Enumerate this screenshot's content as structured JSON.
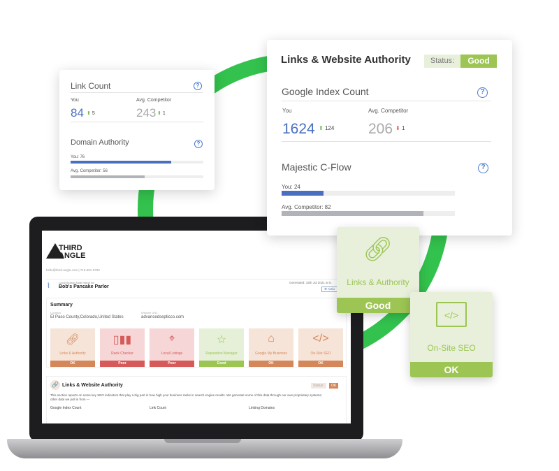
{
  "link_card": {
    "title": "Link Count",
    "you_label": "You",
    "comp_label": "Avg. Competitor",
    "you_value": "84",
    "you_delta": "5",
    "comp_value": "243",
    "comp_delta": "1",
    "da_title": "Domain Authority",
    "da_you": "You: 76",
    "da_comp": "Avg. Competitor: 56",
    "da_you_pct": 76,
    "da_comp_pct": 56
  },
  "authority_card": {
    "title": "Links & Website Authority",
    "status_label": "Status:",
    "status": "Good",
    "gic_title": "Google Index Count",
    "you_label": "You",
    "comp_label": "Avg. Competitor",
    "you_value": "1624",
    "you_delta": "124",
    "comp_value": "206",
    "comp_delta": "1",
    "cflow_title": "Majestic C-Flow",
    "cflow_you": "You: 24",
    "cflow_comp": "Avg. Competitor: 82",
    "cflow_you_pct": 24,
    "cflow_comp_pct": 82
  },
  "green_tiles": [
    {
      "label": "Links & Authority",
      "status": "Good",
      "icon": "link-icon"
    },
    {
      "label": "On-Site SEO",
      "status": "OK",
      "icon": "code-icon"
    }
  ],
  "report": {
    "logo": "THIRD ANGLE",
    "contact": "hello@third-angle.com | 719-591-0790",
    "for_label": "Local Search Audit report for:",
    "business": "Bob's Pancake Parlor",
    "generated": "Generated: 15th Jul 2021 at 5:",
    "action": "Actio",
    "summary_title": "Summary",
    "location_label": "Location:",
    "location": "El Paso County,Colorado,United States",
    "url_label": "Website URL:",
    "url": "advancedsepticco.com",
    "tiles": [
      {
        "label": "Links & Authority",
        "status": "OK",
        "color": "#d4875a",
        "bg": "#f7e4d8"
      },
      {
        "label": "Rank Checker",
        "status": "Poor",
        "color": "#d65a5a",
        "bg": "#f6d6d6"
      },
      {
        "label": "Local Listings",
        "status": "Poor",
        "color": "#d65a5a",
        "bg": "#f6d6d6"
      },
      {
        "label": "Reputation Manager",
        "status": "Good",
        "color": "#9cc553",
        "bg": "#e6f0d8"
      },
      {
        "label": "Google My Business",
        "status": "OK",
        "color": "#d4875a",
        "bg": "#f7e4d8"
      },
      {
        "label": "On-Site SEO",
        "status": "OK",
        "color": "#d4875a",
        "bg": "#f7e4d8"
      }
    ],
    "section_title": "Links & Website Authority",
    "section_status_label": "Status:",
    "section_status": "OK",
    "section_desc": "This section reports on some key SEO indicators that play a big part in how high your business ranks in search engine results. We generate some of this data through our own proprietary systems; other data we pull in from —",
    "cols": [
      "Google Index Count",
      "Link Count",
      "Linking Domains"
    ]
  },
  "colors": {
    "green": "#2ecc40",
    "good": "#9cc553",
    "blue": "#4a6fc0",
    "grey": "#b0b3b8"
  }
}
